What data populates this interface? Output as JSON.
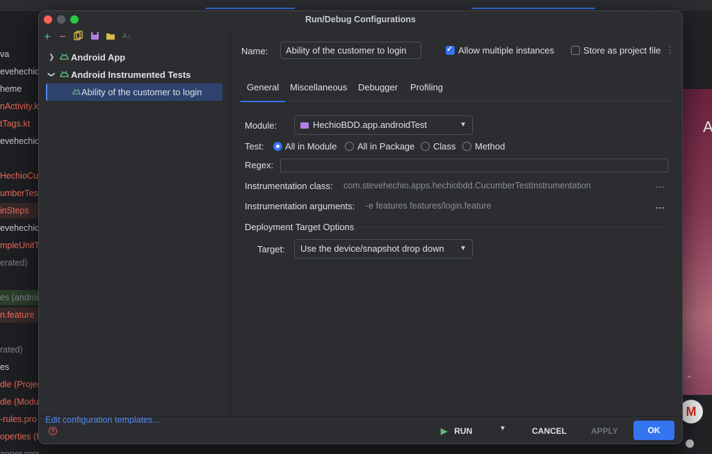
{
  "background": {
    "left_lines": [
      {
        "text": "va",
        "tone": "normal"
      },
      {
        "text": "evehechio",
        "tone": "normal"
      },
      {
        "text": "heme",
        "tone": "normal"
      },
      {
        "text": "nActivity.k",
        "tone": "red"
      },
      {
        "text": "tTags.kt",
        "tone": "red"
      },
      {
        "text": "evehechio",
        "tone": "normal"
      },
      {
        "text": "",
        "tone": "normal"
      },
      {
        "text": "HechioCuc",
        "tone": "red"
      },
      {
        "text": "umberTes",
        "tone": "red"
      },
      {
        "text": "inSteps",
        "tone": "red-hl"
      },
      {
        "text": "evehechio",
        "tone": "normal"
      },
      {
        "text": "mpleUnitT",
        "tone": "red"
      },
      {
        "text": "erated)",
        "tone": "grey"
      },
      {
        "text": "",
        "tone": "normal"
      },
      {
        "text": "es (androi",
        "tone": "grey-hl"
      },
      {
        "text": "n.feature",
        "tone": "red-hl"
      },
      {
        "text": "",
        "tone": "normal"
      },
      {
        "text": "rated)",
        "tone": "grey"
      },
      {
        "text": "es",
        "tone": "normal"
      },
      {
        "text": "dle (Projec",
        "tone": "red"
      },
      {
        "text": "dle (Modu",
        "tone": "red"
      },
      {
        "text": "-rules.pro",
        "tone": "red"
      },
      {
        "text": "operties (F",
        "tone": "red"
      },
      {
        "text": "apper.properties (Gradle Version)",
        "tone": "grey"
      }
    ],
    "right_letter": "A",
    "gmail_letter": "M",
    "right_caret": "⌃"
  },
  "dialog": {
    "title": "Run/Debug Configurations",
    "toolbar_icons": [
      "add-icon",
      "remove-icon",
      "copy-icon",
      "save-icon",
      "folder-icon",
      "sort-icon"
    ],
    "tree": [
      {
        "label": "Android App",
        "expanded": false,
        "level": 0
      },
      {
        "label": "Android Instrumented Tests",
        "expanded": true,
        "level": 0
      },
      {
        "label": "Ability of the customer to login",
        "level": 1,
        "selected": true
      }
    ],
    "edit_templates": "Edit configuration templates…",
    "name_label": "Name:",
    "name_value": "Ability of the customer to login",
    "allow_multiple": {
      "label": "Allow multiple instances",
      "checked": true
    },
    "store_project": {
      "label": "Store as project file",
      "checked": false
    },
    "tabs": [
      {
        "label": "General",
        "active": true
      },
      {
        "label": "Miscellaneous",
        "active": false
      },
      {
        "label": "Debugger",
        "active": false
      },
      {
        "label": "Profiling",
        "active": false
      }
    ],
    "module_label": "Module:",
    "module_value": "HechioBDD.app.androidTest",
    "test_label": "Test:",
    "test_options": [
      {
        "label": "All in Module",
        "selected": true
      },
      {
        "label": "All in Package",
        "selected": false
      },
      {
        "label": "Class",
        "selected": false
      },
      {
        "label": "Method",
        "selected": false
      }
    ],
    "regex_label": "Regex:",
    "regex_value": "",
    "instr_class_label": "Instrumentation class:",
    "instr_class_value": "com.stevehechio.apps.hechiobdd.CucumberTestInstrumentation",
    "instr_args_label": "Instrumentation arguments:",
    "instr_args_value": "-e features features/login.feature",
    "ellipsis": "...",
    "deployment_title": "Deployment Target Options",
    "target_label": "Target:",
    "target_value": "Use the device/snapshot drop down",
    "buttons": {
      "help": "?",
      "run": "RUN",
      "cancel": "CANCEL",
      "apply": "APPLY",
      "ok": "OK"
    }
  },
  "colors": {
    "accent": "#3574f0",
    "dialog_bg": "#2b2d30",
    "text": "#dfe1e5",
    "android_green": "#5fb878",
    "link": "#548af7"
  }
}
